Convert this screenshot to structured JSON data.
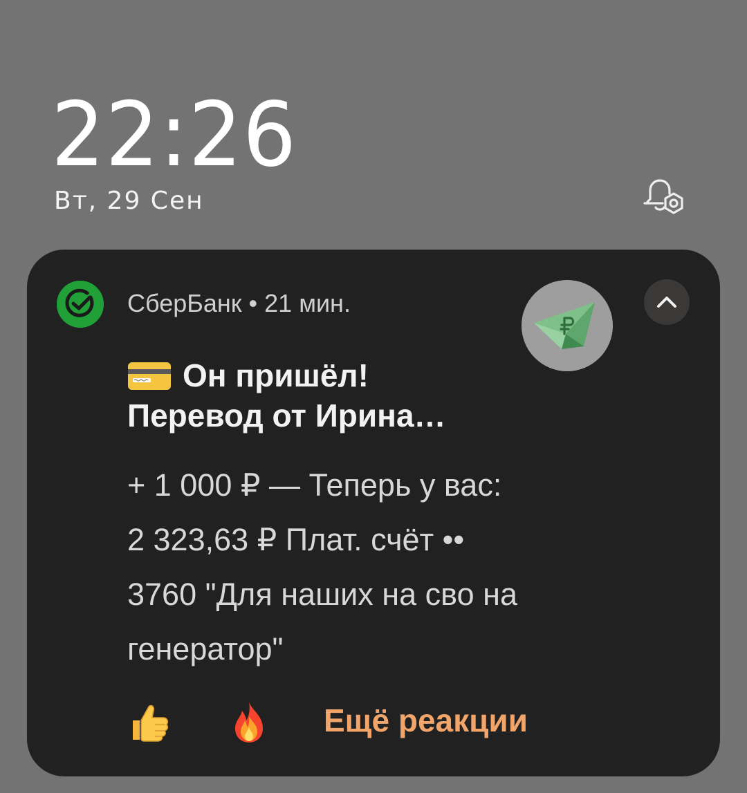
{
  "lockscreen": {
    "time": "22:26",
    "date": "Вт, 29 Сен"
  },
  "notification": {
    "app_name": "СберБанк",
    "separator": "•",
    "elapsed": "21 мин.",
    "title_line1": "Он пришёл!",
    "title_line2": "Перевод от Ирина…",
    "body_lines": [
      "+ 1 000 ₽ — Теперь у вас:",
      "2 323,63 ₽ Плат. счёт ••",
      "3760 \"Для наших на сво на",
      "генератор\""
    ],
    "reactions": [
      {
        "icon": "thumbs-up-icon"
      },
      {
        "icon": "fire-icon"
      }
    ],
    "more_reactions_label": "Ещё реакции",
    "icons": {
      "app": "sberbank-icon",
      "large": "paper-plane-money-icon",
      "collapse": "chevron-up-icon",
      "title": "credit-card-icon",
      "settings": "notification-settings-icon"
    }
  },
  "colors": {
    "background": "#737373",
    "card": "#212121",
    "brand": "#21a038",
    "accent": "#f2a56a"
  }
}
